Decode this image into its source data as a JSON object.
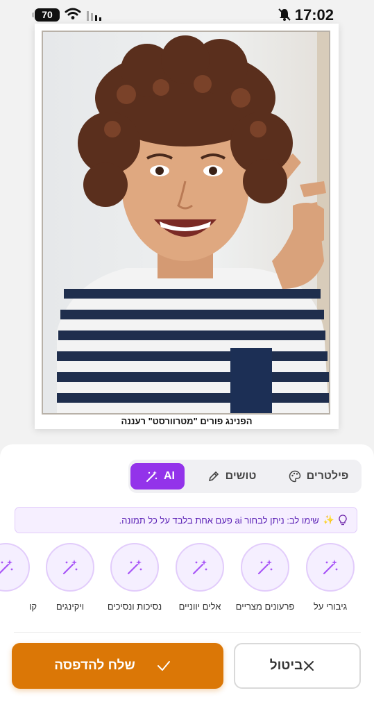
{
  "status_bar": {
    "battery": "70",
    "time": "17:02"
  },
  "photo": {
    "caption": "הפנינג פורים \"מטרוורסט\" רעננה"
  },
  "tabs": [
    {
      "label": "AI",
      "icon": "magic-wand-icon",
      "active": true
    },
    {
      "label": "טושים",
      "icon": "pen-icon",
      "active": false
    },
    {
      "label": "פילטרים",
      "icon": "palette-icon",
      "active": false
    }
  ],
  "notice": {
    "text": "שימו לב: ניתן לבחור ai פעם אחת בלבד על כל תמונה."
  },
  "styles": [
    {
      "label": "גיבורי על"
    },
    {
      "label": "פרעונים מצריים"
    },
    {
      "label": "אלים יווניים"
    },
    {
      "label": "נסיכות ונסיכים"
    },
    {
      "label": "ויקינגים"
    },
    {
      "label": "קו"
    }
  ],
  "buttons": {
    "print": "שלח להדפסה",
    "cancel": "ביטול"
  },
  "colors": {
    "accent": "#9333ea",
    "primary_button": "#db7706",
    "notice_bg": "#f6efff"
  }
}
